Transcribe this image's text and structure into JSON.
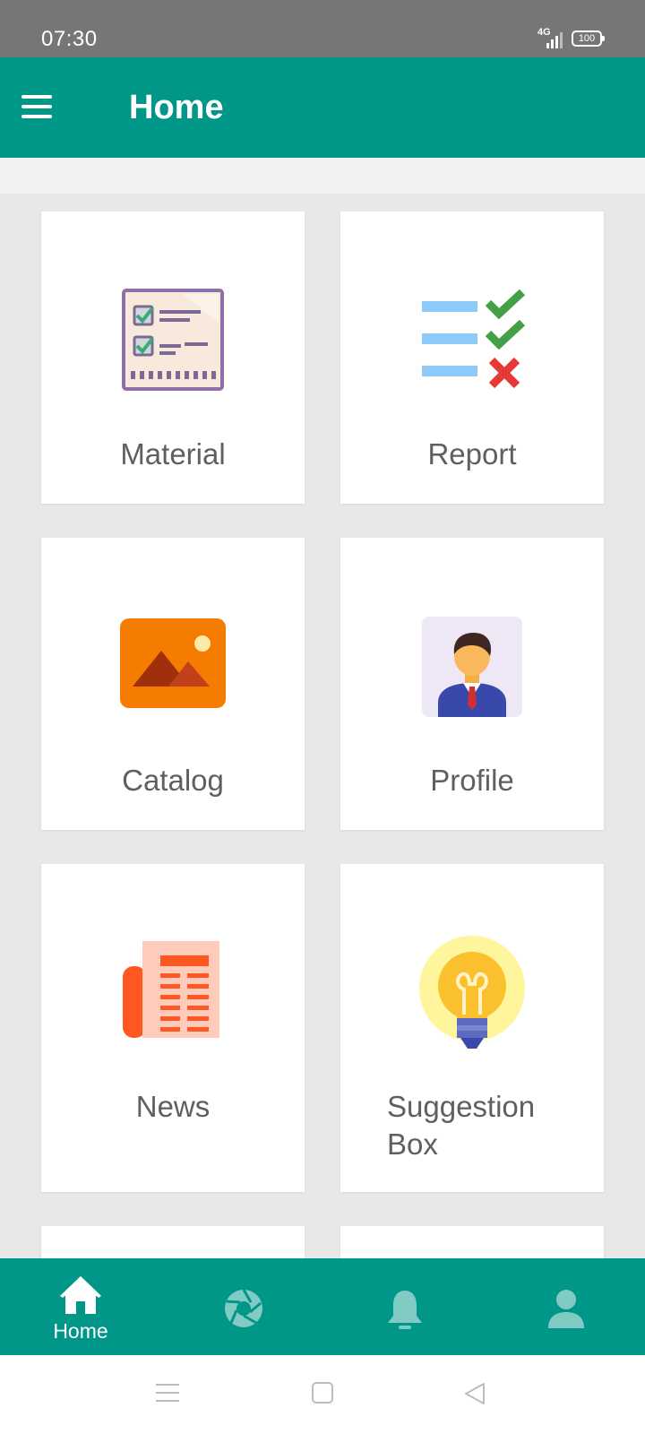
{
  "status_bar": {
    "time": "07:30",
    "network": "4G",
    "battery": "100"
  },
  "app_bar": {
    "title": "Home",
    "menu_icon": "hamburger-menu-icon"
  },
  "tiles": [
    {
      "label": "Material",
      "icon": "checklist-icon"
    },
    {
      "label": "Report",
      "icon": "report-checklist-icon"
    },
    {
      "label": "Catalog",
      "icon": "image-icon"
    },
    {
      "label": "Profile",
      "icon": "person-icon"
    },
    {
      "label": "News",
      "icon": "newspaper-icon"
    },
    {
      "label": "Suggestion Box",
      "icon": "lightbulb-icon"
    }
  ],
  "bottom_nav": {
    "items": [
      {
        "label": "Home",
        "icon": "home-icon",
        "active": true
      },
      {
        "label": "",
        "icon": "aperture-icon",
        "active": false
      },
      {
        "label": "",
        "icon": "bell-icon",
        "active": false
      },
      {
        "label": "",
        "icon": "user-icon",
        "active": false
      }
    ]
  },
  "system_nav": {
    "icons": [
      "recents-icon",
      "home-square-icon",
      "back-triangle-icon"
    ]
  },
  "colors": {
    "primary": "#009688",
    "status_bar": "#767676",
    "background": "#e8e8e8",
    "card": "#ffffff",
    "label_text": "#5f5f5f",
    "nav_inactive": "#80cbc4"
  }
}
